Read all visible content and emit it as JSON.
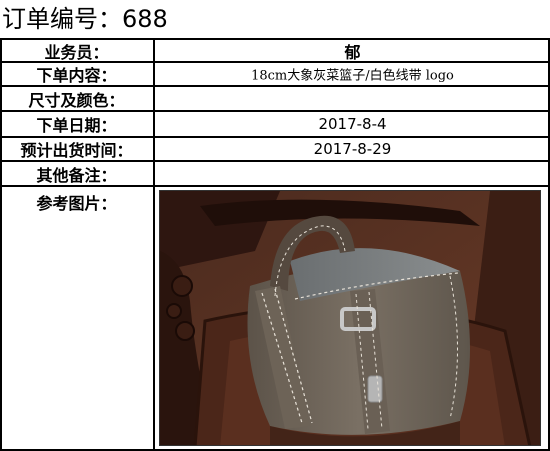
{
  "order": {
    "title": "订单编号：688"
  },
  "fields": [
    {
      "label": "业务员：",
      "value": "郁"
    },
    {
      "label": "下单内容：",
      "value": "18cm大象灰菜篮子/白色线带 logo"
    },
    {
      "label": "尺寸及颜色：",
      "value": ""
    },
    {
      "label": "下单日期：",
      "value": "2017-8-4"
    },
    {
      "label": "预计出货时间：",
      "value": "2017-8-29"
    },
    {
      "label": "其他备注：",
      "value": ""
    },
    {
      "label": "参考图片：",
      "value": ""
    }
  ],
  "colors": {
    "bag": "#6f6559",
    "stitch": "#e8e2d8",
    "wood": "#3a1f17",
    "floor": "#5a3322"
  }
}
